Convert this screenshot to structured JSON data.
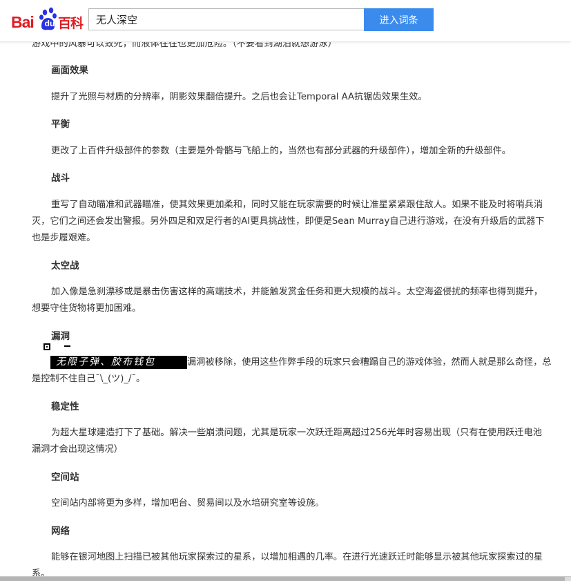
{
  "header": {
    "logo": {
      "bai": "Bai",
      "du": "du",
      "baike": "百科"
    },
    "search": {
      "value": "无人深空",
      "button_label": "进入词条"
    }
  },
  "content": {
    "intro_tail": "游戏中的风暴可以致死，而液体往往也更加危险。（不要看到湖泊就想游泳）",
    "sections": [
      {
        "heading": "画面效果",
        "lines": [
          "提升了光照与材质的分辨率，阴影效果翻倍提升。之后也会让Temporal AA抗锯齿效果生效。"
        ]
      },
      {
        "heading": "平衡",
        "lines": [
          "更改了上百件升级部件的参数（主要是外骨骼与飞船上的，当然也有部分武器的升级部件），增加全新的升级部件。"
        ]
      },
      {
        "heading": "战斗",
        "lines": [
          "重写了自动瞄准和武器瞄准，使其效果更加柔和，同时又能在玩家需要的时候让准星紧紧跟住敌人。如果不能及时将哨兵消",
          "灭，它们之间还会发出警报。另外四足和双足行者的AI更具挑战性，即便是Sean Murray自己进行游戏，在没有升级后的武器下",
          "也是步履艰难。"
        ]
      },
      {
        "heading": "太空战",
        "lines": [
          "加入像是急刹漂移或是暴击伤害这样的高端技术，并能触发赏金任务和更大规模的战斗。太空海盗侵扰的频率也得到提升，",
          "想要守住货物将更加困难。"
        ]
      },
      {
        "heading": "漏洞",
        "lines": [
          "漏洞被移除，使用这些作弊手段的玩家只会糟蹋自己的游戏体验，然而人就是那么奇怪，总",
          "是控制不住自己¯\\_(ツ)_/¯。"
        ]
      },
      {
        "heading": "稳定性",
        "lines": [
          "为超大星球建造打下了基础。解决一些崩溃问题，尤其是玩家一次跃迁距离超过256光年时容易出现（只有在使用跃迁电池",
          "漏洞才会出现这情况）"
        ]
      },
      {
        "heading": "空间站",
        "lines": [
          "空间站内部将更为多样，增加吧台、贸易间以及水培研究室等设施。"
        ]
      },
      {
        "heading": "网络",
        "lines": [
          "能够在银河地图上扫描已被其他玩家探索过的星系，以增加相遇的几率。在进行光速跃迁时能够显示被其他玩家探索过的星",
          "系。"
        ]
      }
    ],
    "overlay_handwriting": "无限子弹、胶布钱包"
  }
}
